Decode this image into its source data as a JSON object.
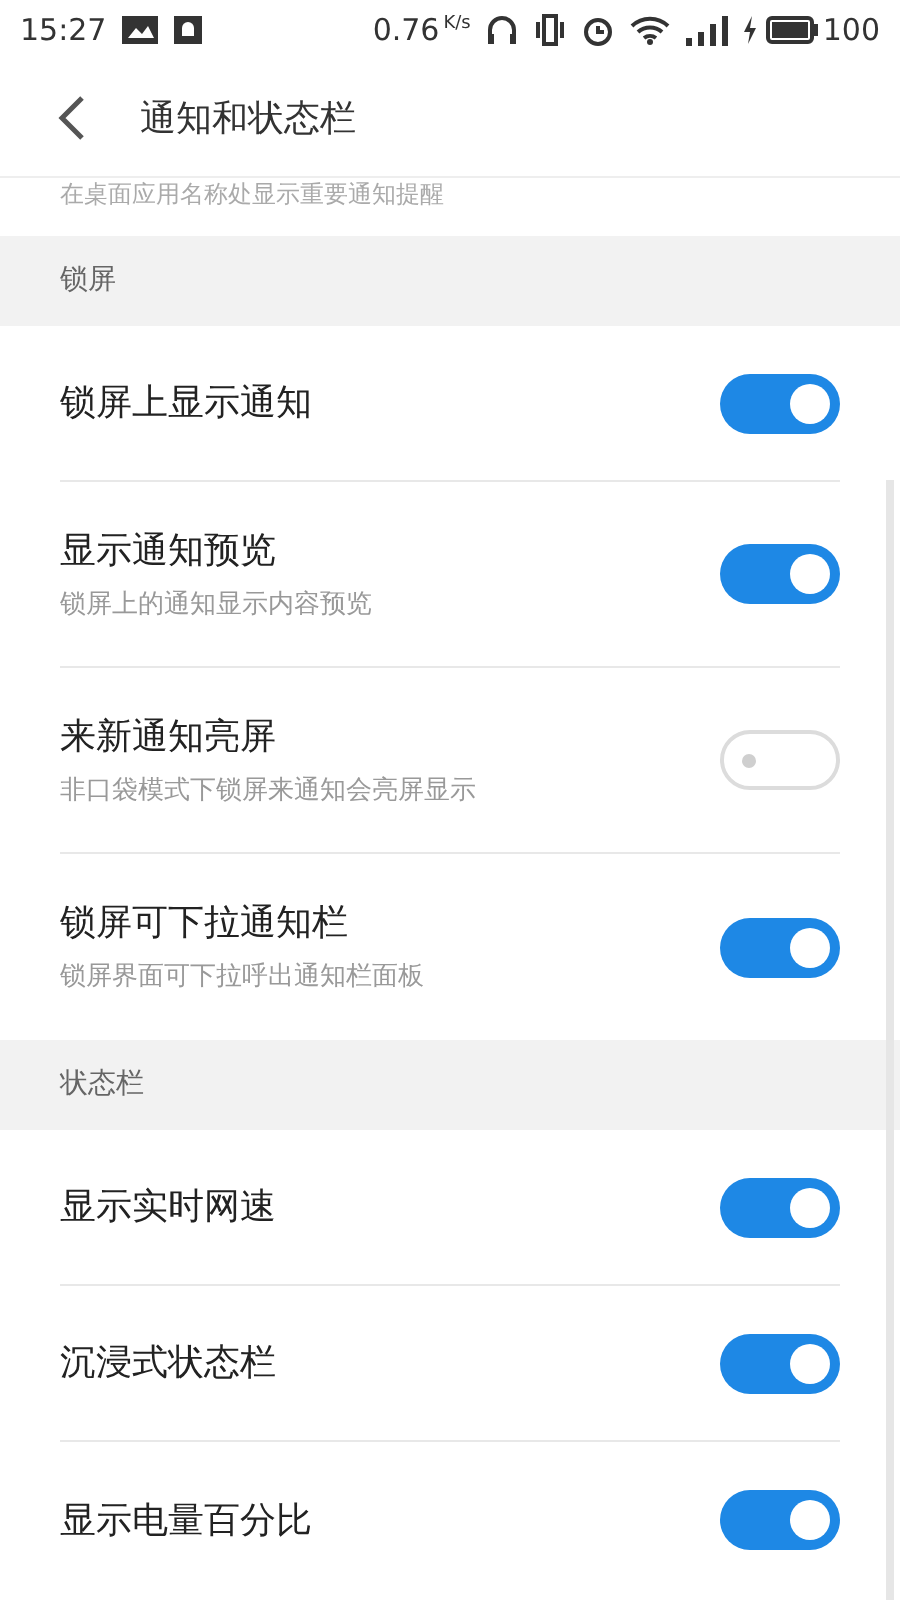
{
  "status_bar": {
    "time": "15:27",
    "net_speed": "0.76",
    "net_unit": "K/s",
    "battery": "100"
  },
  "header": {
    "title": "通知和状态栏"
  },
  "partial_text": "在桌面应用名称处显示重要通知提醒",
  "sections": [
    {
      "title": "锁屏",
      "items": [
        {
          "label": "锁屏上显示通知",
          "on": true
        },
        {
          "label": "显示通知预览",
          "description": "锁屏上的通知显示内容预览",
          "on": true
        },
        {
          "label": "来新通知亮屏",
          "description": "非口袋模式下锁屏来通知会亮屏显示",
          "on": false
        },
        {
          "label": "锁屏可下拉通知栏",
          "description": "锁屏界面可下拉呼出通知栏面板",
          "on": true
        }
      ]
    },
    {
      "title": "状态栏",
      "items": [
        {
          "label": "显示实时网速",
          "on": true
        },
        {
          "label": "沉浸式状态栏",
          "on": true
        },
        {
          "label": "显示电量百分比",
          "on": true
        }
      ]
    }
  ]
}
